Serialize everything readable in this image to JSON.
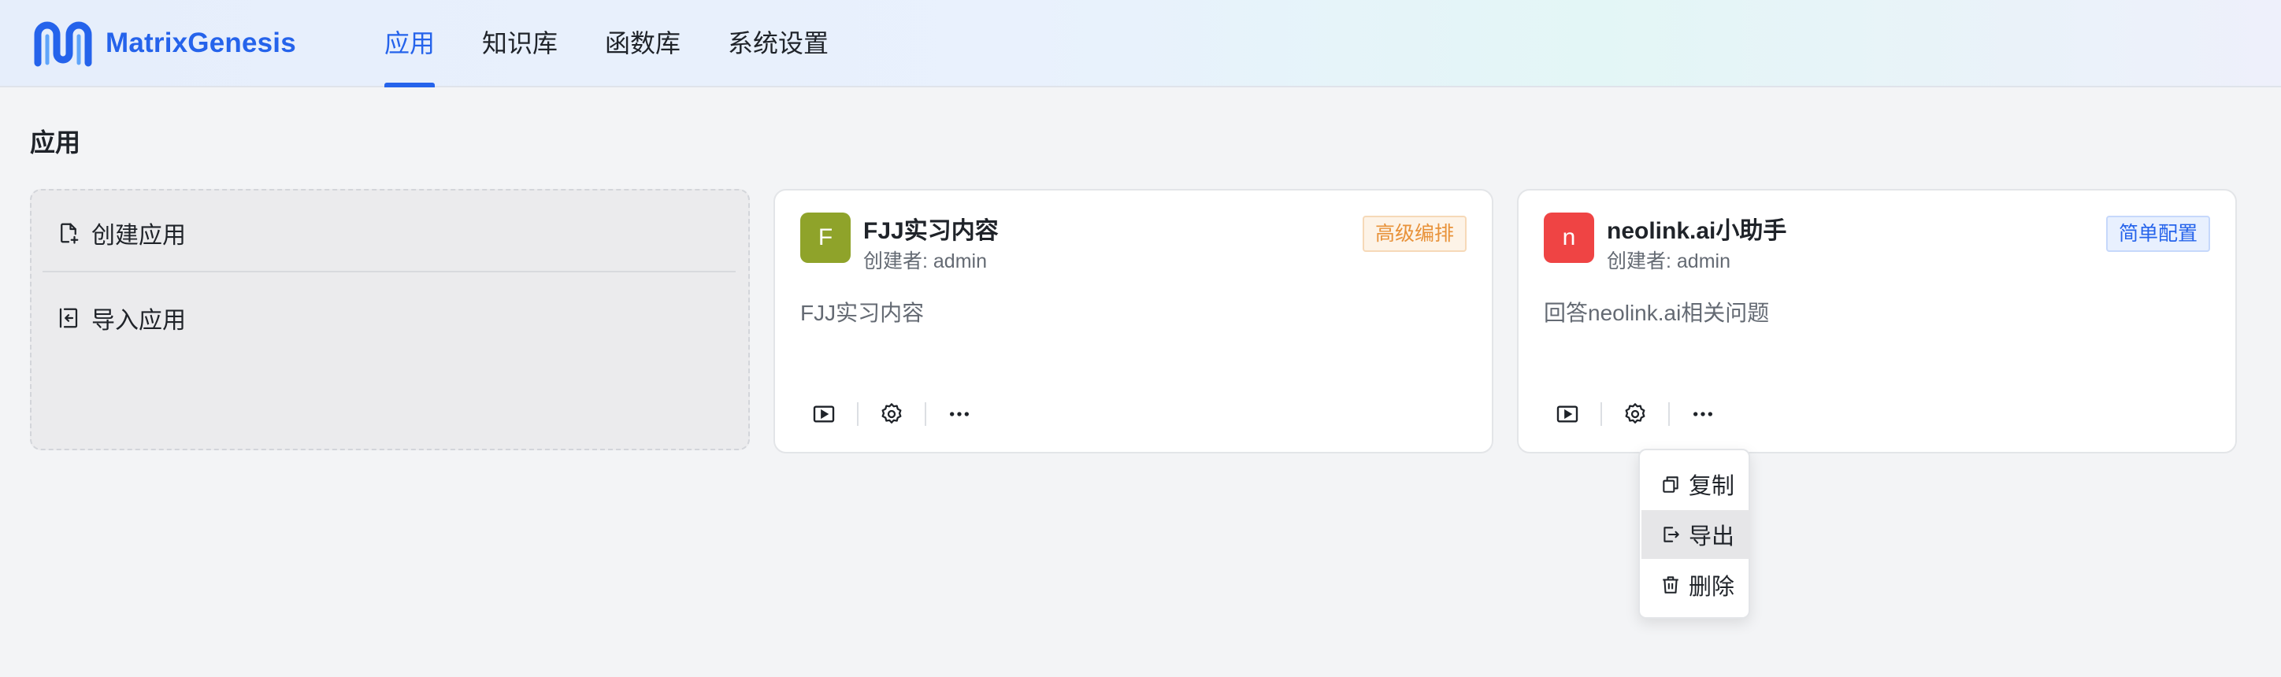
{
  "header": {
    "logo_text": "MatrixGenesis",
    "nav": [
      {
        "label": "应用",
        "active": true
      },
      {
        "label": "知识库",
        "active": false
      },
      {
        "label": "函数库",
        "active": false
      },
      {
        "label": "系统设置",
        "active": false
      }
    ]
  },
  "page": {
    "title": "应用"
  },
  "create_card": {
    "create_label": "创建应用",
    "import_label": "导入应用"
  },
  "apps": [
    {
      "avatar_letter": "F",
      "avatar_color": "#8fa32a",
      "name": "FJJ实习内容",
      "creator": "创建者: admin",
      "tag": "高级编排",
      "tag_color": "#e8923a",
      "tag_bg": "#fdf3e7",
      "description": "FJJ实习内容"
    },
    {
      "avatar_letter": "n",
      "avatar_color": "#ef4444",
      "name": "neolink.ai小助手",
      "creator": "创建者: admin",
      "tag": "简单配置",
      "tag_color": "#2563eb",
      "tag_bg": "#e8f0fe",
      "description": "回答neolink.ai相关问题"
    }
  ],
  "dropdown": {
    "items": [
      {
        "label": "复制",
        "icon": "copy-icon"
      },
      {
        "label": "导出",
        "icon": "export-icon"
      },
      {
        "label": "删除",
        "icon": "trash-icon"
      }
    ]
  },
  "colors": {
    "accent": "#2563eb",
    "page_bg": "#f3f4f6"
  }
}
